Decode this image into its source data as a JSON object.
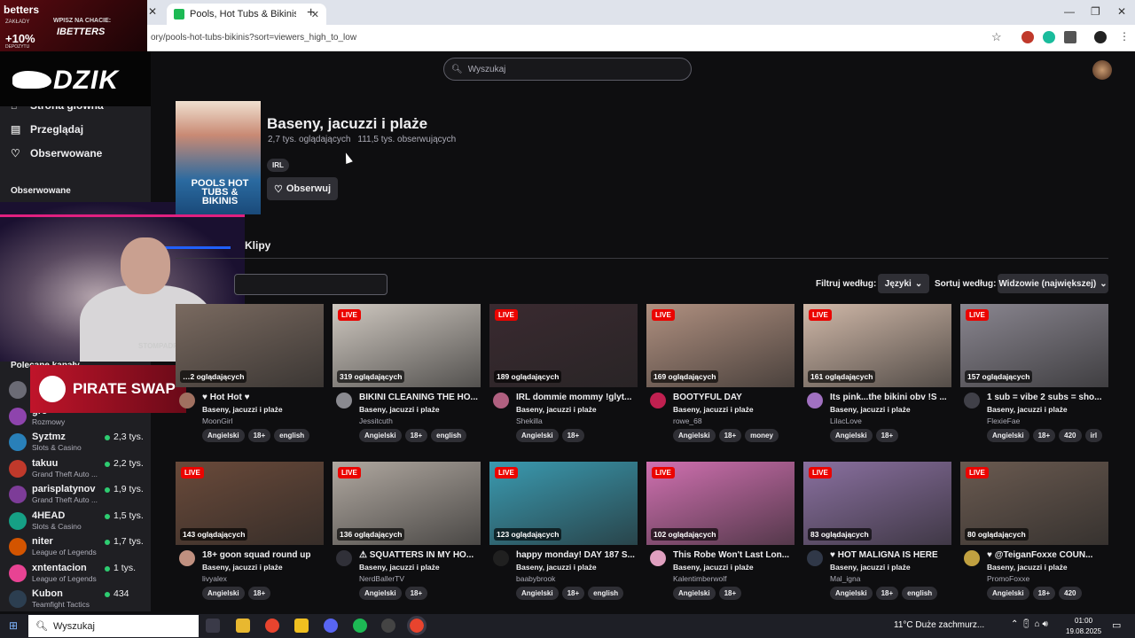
{
  "browser": {
    "tab_title": "Pools, Hot Tubs & Bikinis Stream",
    "url": "ory/pools-hot-tubs-bikinis?sort=viewers_high_to_low"
  },
  "overlay": {
    "promo_brand": "betters",
    "promo_small": "ZAKŁADY",
    "promo_bonus": "+10%",
    "promo_bonus_sub": "DEPOZYTU",
    "promo_line1": "WPISZ NA CHACIE:",
    "promo_line2": "IBETTERS",
    "dzik": "DZIK",
    "cam_tag": "STOMPADRE1",
    "pirate": "PIRATE SWAP"
  },
  "sidebar": {
    "nav": [
      {
        "label": "Strona główna",
        "icon": "home-icon"
      },
      {
        "label": "Przeglądaj",
        "icon": "browse-icon"
      },
      {
        "label": "Obserwowane",
        "icon": "heart-icon"
      }
    ],
    "followed_title": "Obserwowane",
    "recommended_title": "Polecane kanały",
    "channels": [
      {
        "name": "Vy",
        "category": "",
        "viewers": "",
        "color": "#6b6b75"
      },
      {
        "name": "gre",
        "category": "Rozmowy",
        "viewers": "",
        "color": "#8e44ad"
      },
      {
        "name": "Syztmz",
        "category": "Slots & Casino",
        "viewers": "2,3 tys.",
        "color": "#2980b9"
      },
      {
        "name": "takuu",
        "category": "Grand Theft Auto ...",
        "viewers": "2,2 tys.",
        "color": "#c0392b"
      },
      {
        "name": "parisplatynov",
        "category": "Grand Theft Auto ...",
        "viewers": "1,9 tys.",
        "color": "#7d3c98"
      },
      {
        "name": "4HEAD",
        "category": "Slots & Casino",
        "viewers": "1,5 tys.",
        "color": "#16a085"
      },
      {
        "name": "niter",
        "category": "League of Legends",
        "viewers": "1,7 tys.",
        "color": "#d35400"
      },
      {
        "name": "xntentacion",
        "category": "League of Legends",
        "viewers": "1 tys.",
        "color": "#e84393"
      },
      {
        "name": "Kubon",
        "category": "Teamfight Tactics",
        "viewers": "434",
        "color": "#2c3e50"
      }
    ]
  },
  "header": {
    "search_placeholder": "Wyszukaj"
  },
  "category": {
    "title": "Baseny, jacuzzi i plaże",
    "viewers": "2,7 tys. oglądających",
    "followers": "111,5 tys. obserwujących",
    "tag": "IRL",
    "follow_label": "Obserwuj",
    "cover_text": "POOLS HOT TUBS & BIKINIS",
    "tab_clips": "Klipy",
    "filter_label": "Filtruj według:",
    "language_select": "Języki",
    "sort_label": "Sortuj według:",
    "sort_select": "Widzowie (największej)"
  },
  "streams": [
    {
      "title": "♥ Hot Hot ♥",
      "viewers": "…2 oglądających",
      "category": "Baseny, jacuzzi i plaże",
      "streamer": "MoonGirl",
      "tags": [
        "Angielski",
        "18+",
        "english"
      ],
      "live": false,
      "thumb": "#7a6a60",
      "avatar": "#a07060"
    },
    {
      "title": "BIKINI CLEANING THE HO...",
      "viewers": "319 oglądających",
      "category": "Baseny, jacuzzi i plaże",
      "streamer": "Jessitcuth",
      "tags": [
        "Angielski",
        "18+",
        "english"
      ],
      "live": true,
      "thumb": "#cfc8c0",
      "avatar": "#8a8a90"
    },
    {
      "title": "IRL dommie mommy !glyt...",
      "viewers": "189 oglądających",
      "category": "Baseny, jacuzzi i plaże",
      "streamer": "Shekilla",
      "tags": [
        "Angielski",
        "18+"
      ],
      "live": true,
      "thumb": "#3a2a30",
      "avatar": "#b06080"
    },
    {
      "title": "BOOTYFUL DAY",
      "viewers": "169 oglądających",
      "category": "Baseny, jacuzzi i plaże",
      "streamer": "rowe_68",
      "tags": [
        "Angielski",
        "18+",
        "money"
      ],
      "live": true,
      "thumb": "#b09080",
      "avatar": "#c02050"
    },
    {
      "title": "Its pink...the bikini obv !S ...",
      "viewers": "161 oglądających",
      "category": "Baseny, jacuzzi i plaże",
      "streamer": "LilacLove",
      "tags": [
        "Angielski",
        "18+"
      ],
      "live": true,
      "thumb": "#d0b8a8",
      "avatar": "#a070c0"
    },
    {
      "title": "1 sub = vibe 2 subs = sho...",
      "viewers": "157 oglądających",
      "category": "Baseny, jacuzzi i plaże",
      "streamer": "FlexieFae",
      "tags": [
        "Angielski",
        "18+",
        "420",
        "irl"
      ],
      "live": true,
      "thumb": "#8a8690",
      "avatar": "#404048"
    },
    {
      "title": "18+ goon squad round up",
      "viewers": "143 oglądających",
      "category": "Baseny, jacuzzi i plaże",
      "streamer": "livyalex",
      "tags": [
        "Angielski",
        "18+"
      ],
      "live": true,
      "thumb": "#6a4a3a",
      "avatar": "#c09080"
    },
    {
      "title": "⚠ SQUATTERS IN MY HO...",
      "viewers": "136 oglądających",
      "category": "Baseny, jacuzzi i plaże",
      "streamer": "NerdBallerTV",
      "tags": [
        "Angielski",
        "18+"
      ],
      "live": true,
      "thumb": "#b0a8a0",
      "avatar": "#303038"
    },
    {
      "title": "happy monday! DAY 187 S...",
      "viewers": "123 oglądających",
      "category": "Baseny, jacuzzi i plaże",
      "streamer": "baabybrook",
      "tags": [
        "Angielski",
        "18+",
        "english"
      ],
      "live": true,
      "thumb": "#3a9ab0",
      "avatar": "#202020"
    },
    {
      "title": "This Robe Won't Last Lon...",
      "viewers": "102 oglądających",
      "category": "Baseny, jacuzzi i plaże",
      "streamer": "Kalentimberwolf",
      "tags": [
        "Angielski",
        "18+"
      ],
      "live": true,
      "thumb": "#d070b0",
      "avatar": "#e0a0c0"
    },
    {
      "title": "♥ HOT MALIGNA IS HERE",
      "viewers": "83 oglądających",
      "category": "Baseny, jacuzzi i plaże",
      "streamer": "Mal_igna",
      "tags": [
        "Angielski",
        "18+",
        "english"
      ],
      "live": true,
      "thumb": "#8a70a0",
      "avatar": "#303848"
    },
    {
      "title": "♥ @TeiganFoxxe COUN...",
      "viewers": "80 oglądających",
      "category": "Baseny, jacuzzi i plaże",
      "streamer": "PromoFoxxe",
      "tags": [
        "Angielski",
        "18+",
        "420"
      ],
      "live": true,
      "thumb": "#6a5a50",
      "avatar": "#c0a040"
    }
  ],
  "taskbar": {
    "search_label": "Wyszukaj",
    "weather": "11°C  Duże zachmurz...",
    "time": "01:00",
    "date": "19.08.2025"
  }
}
